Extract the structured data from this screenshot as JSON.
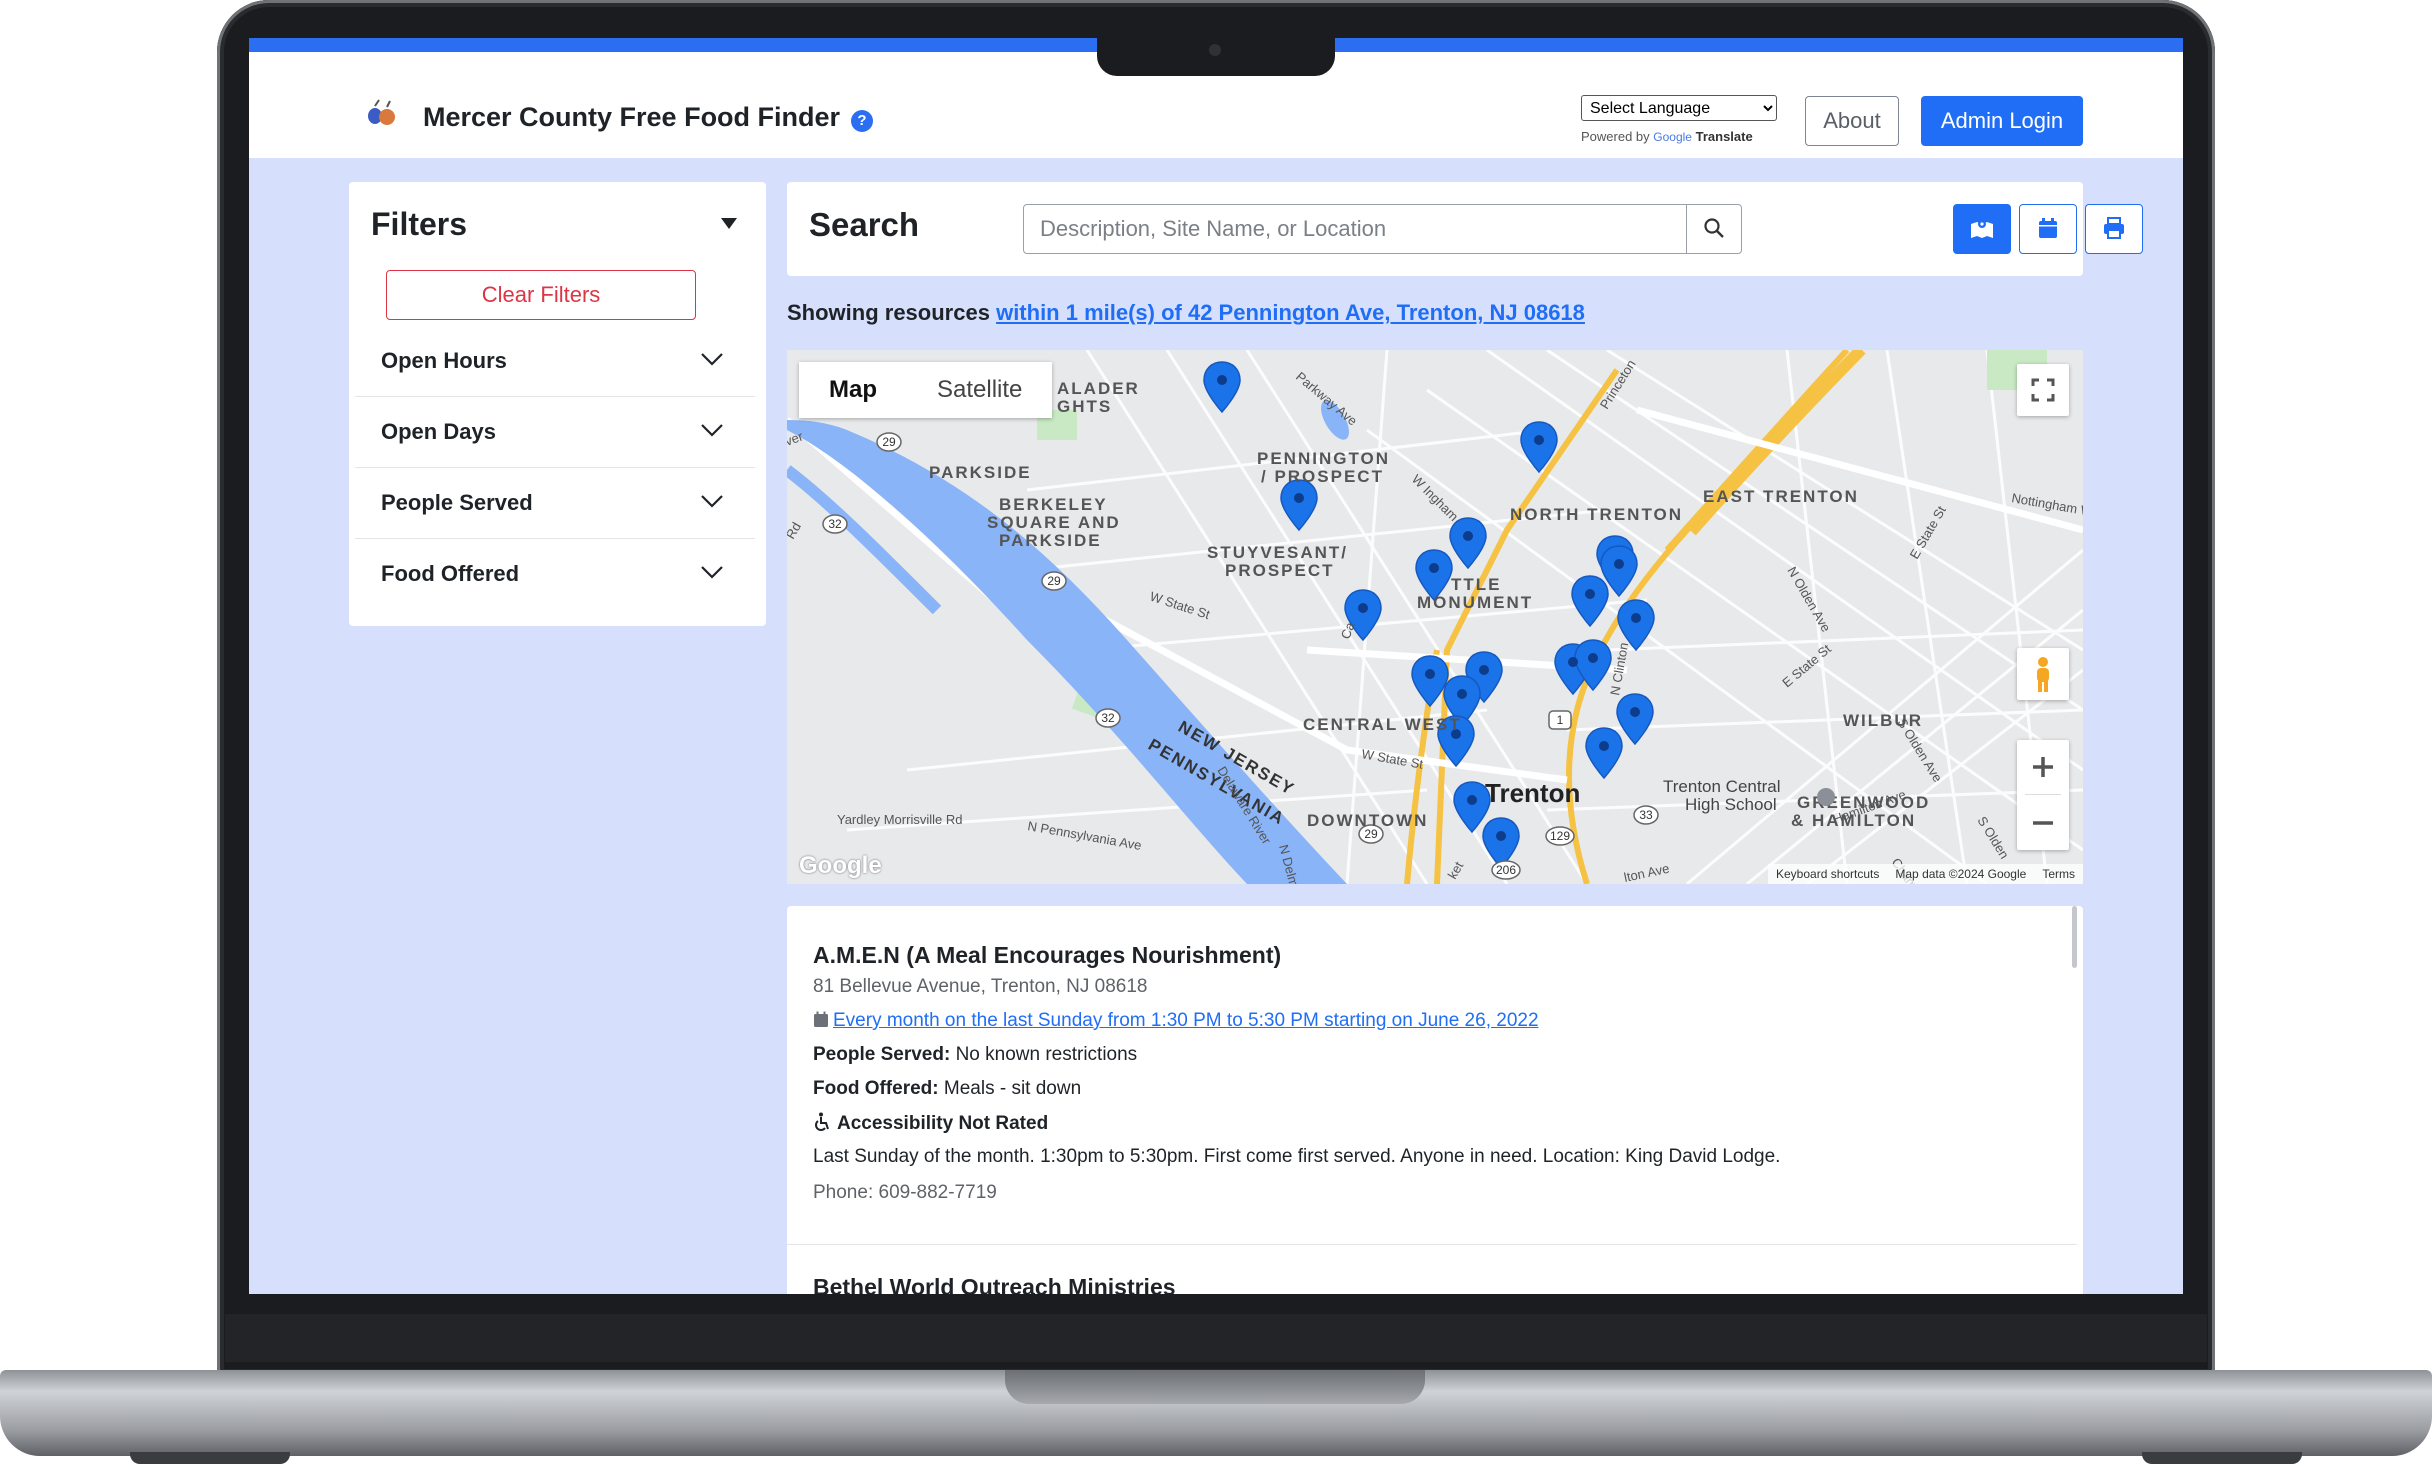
{
  "header": {
    "title": "Mercer County Free Food Finder",
    "help_glyph": "?",
    "language_select": "Select Language",
    "powered_by": "Powered by",
    "google_word": "Google",
    "translate_word": "Translate",
    "about_label": "About",
    "admin_label": "Admin Login"
  },
  "filters": {
    "title": "Filters",
    "clear_label": "Clear Filters",
    "items": [
      {
        "label": "Open Hours"
      },
      {
        "label": "Open Days"
      },
      {
        "label": "People Served"
      },
      {
        "label": "Food Offered"
      }
    ]
  },
  "search": {
    "title": "Search",
    "placeholder": "Description, Site Name, or Location",
    "view_buttons": [
      "map-icon",
      "calendar-icon",
      "printer-icon"
    ]
  },
  "showing": {
    "prefix": "Showing resources",
    "link": "within 1 mile(s) of 42 Pennington Ave, Trenton, NJ 08618"
  },
  "map": {
    "tabs": [
      "Map",
      "Satellite"
    ],
    "labels": {
      "aladder": "ALADER",
      "ghts": "GHTS",
      "parkside": "PARKSIDE",
      "pennington_prospect_1": "PENNINGTON",
      "pennington_prospect_2": "/ PROSPECT",
      "berkeley_1": "BERKELEY",
      "berkeley_2": "SQUARE AND",
      "berkeley_3": "PARKSIDE",
      "north_trenton": "NORTH TRENTON",
      "east_trenton": "EAST TRENTON",
      "stuyvesant_1": "STUYVESANT/",
      "stuyvesant_2": "PROSPECT",
      "little_monument_1": "TTLE",
      "little_monument_2": "MONUMENT",
      "central_west": "CENTRAL WEST",
      "wilbur": "WILBUR",
      "trenton": "Trenton",
      "new_jersey": "NEW JERSEY",
      "pennsylvania": "PENNSYLVANIA",
      "downtown": "DOWNTOWN",
      "trenton_central_1": "Trenton Central",
      "trenton_central_2": "High School",
      "greenwood_1": "GREENWOOD",
      "greenwood_2": "& HAMILTON",
      "delaware_river": "Delaware River",
      "princeton": "Princeton",
      "parkway_ave": "Parkway Ave",
      "w_state_st": "W State St",
      "w_state_st_2": "W State St",
      "e_state_st": "E State St",
      "yardley": "Yardley Morrisville Rd",
      "n_penn_ave": "N Pennsylvania Ave",
      "route_29a": "29",
      "route_32a": "32",
      "route_29b": "29",
      "route_32b": "32",
      "route_1": "1",
      "route_29c": "29",
      "route_129": "129",
      "route_33": "33",
      "route_206": "206",
      "n_olden": "N Olden Ave",
      "s_olden": "S Olden Ave",
      "hamilton_ave": "Hamilton Ave",
      "nottingham": "Nottingham W",
      "w_ingham": "W Ingham",
      "rd": "Rd",
      "ver": "ver",
      "e_state_st_2": "E State St",
      "n_clinton": "N Clinton",
      "n_delmor": "N Delmor",
      "s_olden_2": "S Olden",
      "chambers": "Chamb",
      "lton_ave": "lton Ave",
      "ket": "ket",
      "ca": "Ca"
    },
    "google_logo": "Google",
    "footer": [
      "Keyboard shortcuts",
      "Map data ©2024 Google",
      "Terms"
    ],
    "accent_color": "#1a73e8"
  },
  "results": [
    {
      "name": "A.M.E.N (A Meal Encourages Nourishment)",
      "address": "81 Bellevue Avenue, Trenton, NJ 08618",
      "schedule": "Every month on the last Sunday from 1:30 PM to 5:30 PM starting on June 26, 2022",
      "people_label": "People Served:",
      "people_value": "No known restrictions",
      "food_label": "Food Offered:",
      "food_value": "Meals - sit down",
      "accessibility": "Accessibility Not Rated",
      "description": "Last Sunday of the month. 1:30pm to 5:30pm. First come first served. Anyone in need. Location: King David Lodge.",
      "phone": "Phone: 609-882-7719"
    },
    {
      "name": "Bethel World Outreach Ministries"
    }
  ]
}
